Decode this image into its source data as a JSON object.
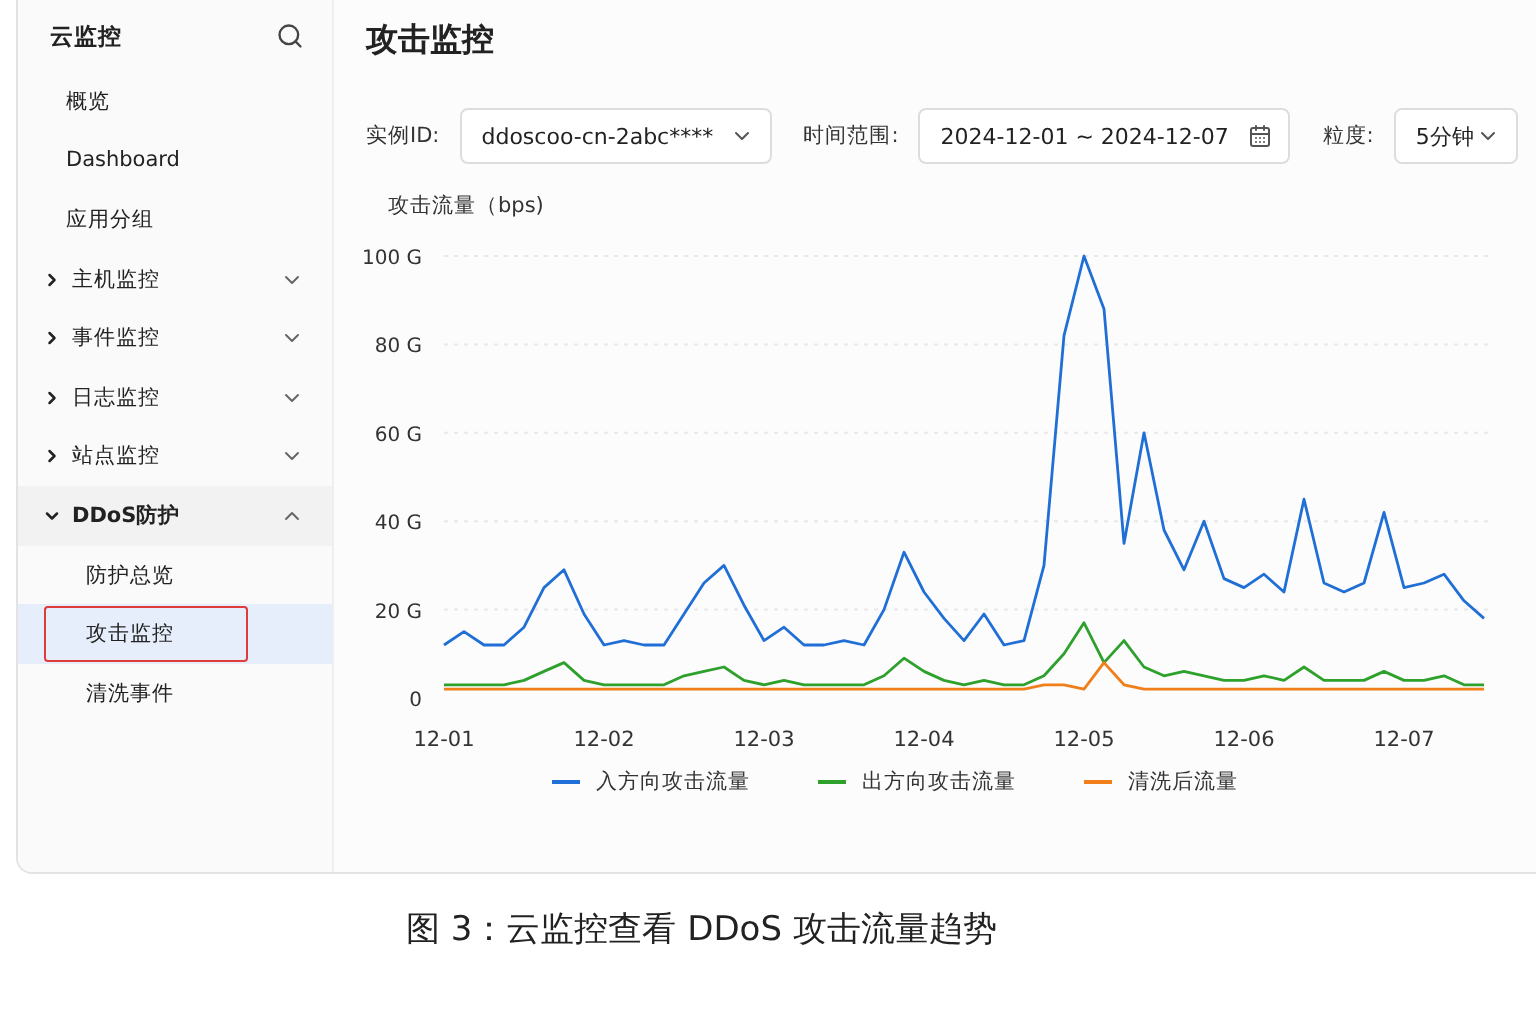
{
  "sidebar": {
    "title": "云监控",
    "items": [
      {
        "kind": "link",
        "label": "概览",
        "selected": false,
        "annotated": false
      },
      {
        "kind": "link",
        "label": "Dashboard",
        "selected": false,
        "annotated": false
      },
      {
        "kind": "link",
        "label": "应用分组",
        "selected": false,
        "annotated": false
      },
      {
        "kind": "group",
        "label": "主机监控",
        "expanded": false,
        "selected": false,
        "annotated": false
      },
      {
        "kind": "group",
        "label": "事件监控",
        "expanded": false,
        "selected": false,
        "annotated": false
      },
      {
        "kind": "group",
        "label": "日志监控",
        "expanded": false,
        "selected": false,
        "annotated": false
      },
      {
        "kind": "group",
        "label": "站点监控",
        "expanded": false,
        "selected": false,
        "annotated": false
      },
      {
        "kind": "group",
        "label": "DDoS防护",
        "expanded": true,
        "selected": false,
        "annotated": false,
        "children": [
          {
            "kind": "link",
            "label": "防护总览",
            "selected": false,
            "annotated": false
          },
          {
            "kind": "link",
            "label": "攻击监控",
            "selected": true,
            "annotated": true
          },
          {
            "kind": "link",
            "label": "清洗事件",
            "selected": false,
            "annotated": false
          }
        ]
      }
    ]
  },
  "page_title": "攻击监控",
  "filters": [
    {
      "kind": "select",
      "label": "实例ID:",
      "value": "ddoscoo-cn-2abc****"
    },
    {
      "kind": "date",
      "label": "时间范围:",
      "value": "2024-12-01 ~ 2024-12-07"
    },
    {
      "kind": "select",
      "label": "粒度:",
      "value": "5分钟"
    }
  ],
  "chart_title": "攻击流量（bps)",
  "chart_data": {
    "type": "line",
    "categories": [
      "12-01",
      null,
      null,
      null,
      null,
      null,
      null,
      null,
      "12-02",
      null,
      null,
      null,
      null,
      null,
      null,
      null,
      "12-03",
      null,
      null,
      null,
      null,
      null,
      null,
      null,
      "12-04",
      null,
      null,
      null,
      null,
      null,
      null,
      null,
      "12-05",
      null,
      null,
      null,
      null,
      null,
      null,
      null,
      "12-06",
      null,
      null,
      null,
      null,
      null,
      null,
      null,
      "12-07",
      null,
      null,
      null,
      null
    ],
    "series": [
      {
        "name": "入方向攻击流量",
        "color": "#1f6fd6",
        "values": [
          12,
          15,
          12,
          12,
          16,
          25,
          29,
          19,
          12,
          13,
          12,
          12,
          19,
          26,
          30,
          21,
          13,
          16,
          12,
          12,
          13,
          12,
          20,
          33,
          24,
          18,
          13,
          19,
          12,
          13,
          30,
          82,
          100,
          88,
          35,
          60,
          38,
          29,
          40,
          27,
          25,
          28,
          24,
          45,
          26,
          24,
          26,
          42,
          25,
          26,
          28,
          22,
          18
        ]
      },
      {
        "name": "出方向攻击流量",
        "color": "#2ea02c",
        "values": [
          3,
          3,
          3,
          3,
          4,
          6,
          8,
          4,
          3,
          3,
          3,
          3,
          5,
          6,
          7,
          4,
          3,
          4,
          3,
          3,
          3,
          3,
          5,
          9,
          6,
          4,
          3,
          4,
          3,
          3,
          5,
          10,
          17,
          8,
          13,
          7,
          5,
          6,
          5,
          4,
          4,
          5,
          4,
          7,
          4,
          4,
          4,
          6,
          4,
          4,
          5,
          3,
          3
        ]
      },
      {
        "name": "清洗后流量",
        "color": "#f07f1a",
        "values": [
          2,
          2,
          2,
          2,
          2,
          2,
          2,
          2,
          2,
          2,
          2,
          2,
          2,
          2,
          2,
          2,
          2,
          2,
          2,
          2,
          2,
          2,
          2,
          2,
          2,
          2,
          2,
          2,
          2,
          2,
          3,
          3,
          2,
          8,
          3,
          2,
          2,
          2,
          2,
          2,
          2,
          2,
          2,
          2,
          2,
          2,
          2,
          2,
          2,
          2,
          2,
          2,
          2
        ]
      }
    ],
    "ylim": [
      0,
      100
    ],
    "grid": true,
    "yticks": [
      {
        "value": 0,
        "label": "0"
      },
      {
        "value": 20,
        "label": "20 G"
      },
      {
        "value": 40,
        "label": "40 G"
      },
      {
        "value": 60,
        "label": "60 G"
      },
      {
        "value": 80,
        "label": "80 G"
      },
      {
        "value": 100,
        "label": "100 G"
      }
    ]
  },
  "caption": "图 3：云监控查看 DDoS 攻击流量趋势"
}
